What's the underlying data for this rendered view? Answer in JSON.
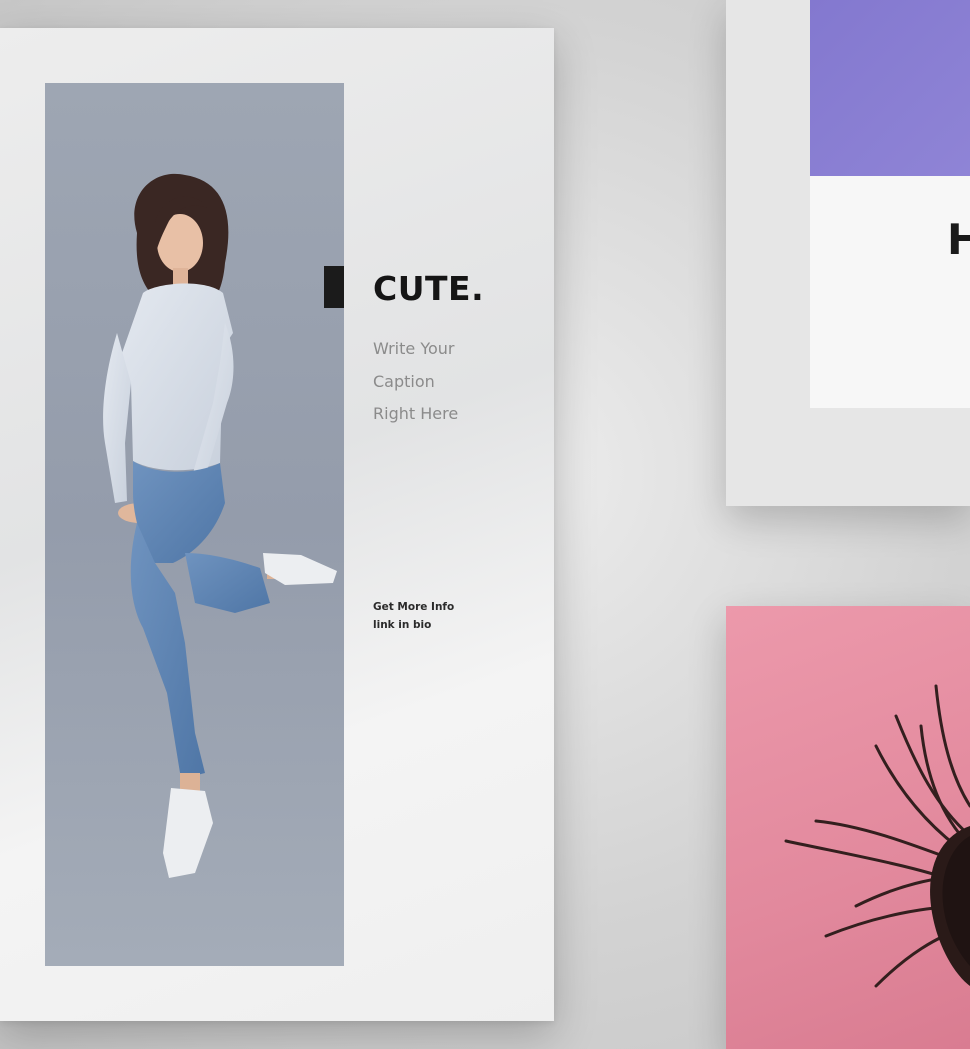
{
  "main_card": {
    "headline": "CUTE.",
    "caption_lines": [
      "Write Your",
      "Caption",
      "Right Here"
    ],
    "info_lines": [
      "Get More Info",
      "link in bio"
    ],
    "photo_background": "#9ea6b3"
  },
  "top_right_card": {
    "partial_headline": "H",
    "accent_color": "#8378cf"
  },
  "bottom_right_card": {
    "background_color": "#e2899d"
  }
}
